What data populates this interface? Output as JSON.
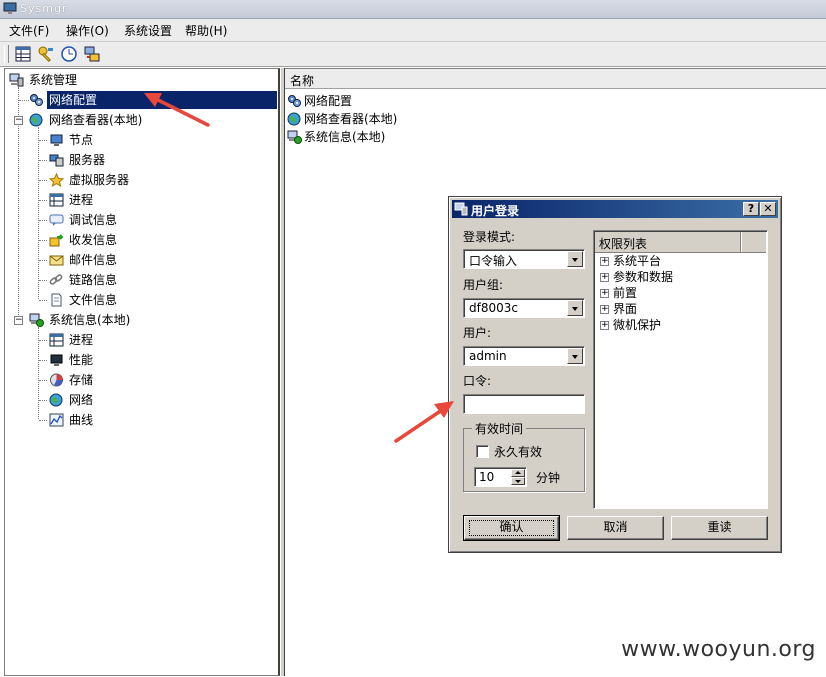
{
  "window": {
    "title": "Sysmgr"
  },
  "menu": [
    "文件(F)",
    "操作(O)",
    "系统设置",
    "帮助(H)"
  ],
  "toolbar": {
    "icons": [
      "grid-icon",
      "key-icon",
      "clock-icon",
      "connect-icon"
    ]
  },
  "tree": {
    "root": "系统管理",
    "network_config": "网络配置",
    "viewer": "网络查看器(本地)",
    "viewer_children": [
      "节点",
      "服务器",
      "虚拟服务器",
      "进程",
      "调试信息",
      "收发信息",
      "邮件信息",
      "链路信息",
      "文件信息"
    ],
    "sysinfo": "系统信息(本地)",
    "sysinfo_children": [
      "进程",
      "性能",
      "存储",
      "网络",
      "曲线"
    ]
  },
  "list": {
    "column": "名称",
    "items": [
      "网络配置",
      "网络查看器(本地)",
      "系统信息(本地)"
    ]
  },
  "dialog": {
    "title": "用户登录",
    "help_btn": "?",
    "close_btn": "✕",
    "mode_label": "登录模式:",
    "mode_value": "口令输入",
    "group_label": "用户组:",
    "group_value": "df8003c",
    "user_label": "用户:",
    "user_value": "admin",
    "password_label": "口令:",
    "password_value": "",
    "validity_group": "有效时间",
    "permanent_label": "永久有效",
    "minutes_value": "10",
    "minutes_unit": "分钟",
    "perm_header": "权限列表",
    "perm_items": [
      "系统平台",
      "参数和数据",
      "前置",
      "界面",
      "微机保护"
    ],
    "ok": "确认",
    "cancel": "取消",
    "reset": "重读"
  },
  "watermark": "www.wooyun.org",
  "colors": {
    "selection": "#0a246a",
    "arrow": "#e8473a",
    "dialog_face": "#d4d0c8"
  }
}
